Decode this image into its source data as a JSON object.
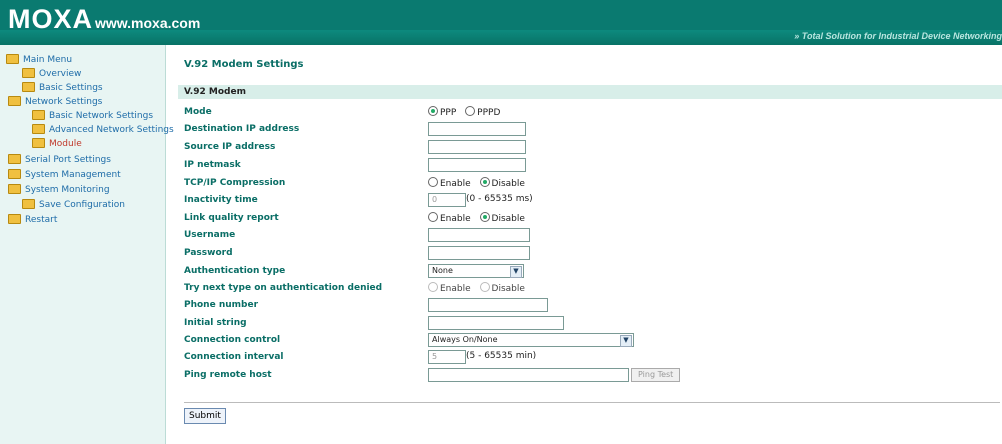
{
  "header": {
    "logo": "MOXA",
    "site": "www.moxa.com",
    "tagline": "» Total Solution for Industrial Device Networking"
  },
  "sidebar": {
    "main_menu": "Main Menu",
    "items": [
      {
        "label": "Overview",
        "icon": "folder-icon"
      },
      {
        "label": "Basic Settings",
        "icon": "folder-icon"
      },
      {
        "label": "Network Settings",
        "icon": "folder-icon"
      },
      {
        "label": "Basic Network Settings",
        "icon": "folder-icon"
      },
      {
        "label": "Advanced Network Settings",
        "icon": "folder-icon"
      },
      {
        "label": "Module",
        "icon": "folder-icon"
      },
      {
        "label": "Serial Port Settings",
        "icon": "folder-icon"
      },
      {
        "label": "System Management",
        "icon": "folder-icon"
      },
      {
        "label": "System Monitoring",
        "icon": "folder-icon"
      },
      {
        "label": "Save Configuration",
        "icon": "folder-icon"
      },
      {
        "label": "Restart",
        "icon": "folder-icon"
      }
    ]
  },
  "main": {
    "title": "V.92 Modem Settings",
    "section": "V.92 Modem",
    "fields": {
      "mode": {
        "label": "Mode",
        "opt1": "PPP",
        "opt2": "PPPD"
      },
      "dest_ip": {
        "label": "Destination IP address",
        "value": ""
      },
      "src_ip": {
        "label": "Source IP address",
        "value": ""
      },
      "netmask": {
        "label": "IP netmask",
        "value": ""
      },
      "tcpip_comp": {
        "label": "TCP/IP Compression",
        "opt1": "Enable",
        "opt2": "Disable"
      },
      "inactivity": {
        "label": "Inactivity time",
        "value": "0",
        "unit": "(0 - 65535 ms)"
      },
      "lqr": {
        "label": "Link quality report",
        "opt1": "Enable",
        "opt2": "Disable"
      },
      "username": {
        "label": "Username",
        "value": ""
      },
      "password": {
        "label": "Password",
        "value": ""
      },
      "auth_type": {
        "label": "Authentication type",
        "value": "None"
      },
      "try_next": {
        "label": "Try next type on authentication denied",
        "opt1": "Enable",
        "opt2": "Disable"
      },
      "phone": {
        "label": "Phone number",
        "value": ""
      },
      "init_string": {
        "label": "Initial string",
        "value": ""
      },
      "conn_control": {
        "label": "Connection control",
        "value": "Always On/None"
      },
      "conn_interval": {
        "label": "Connection interval",
        "value": "5",
        "unit": "(5 - 65535 min)"
      },
      "ping": {
        "label": "Ping remote host",
        "value": "",
        "button": "Ping Test"
      }
    },
    "submit": "Submit"
  },
  "colors": {
    "brand": "#0a7a70",
    "label": "#0a6e66",
    "link": "#1e6ca8",
    "active": "#c0392b"
  }
}
